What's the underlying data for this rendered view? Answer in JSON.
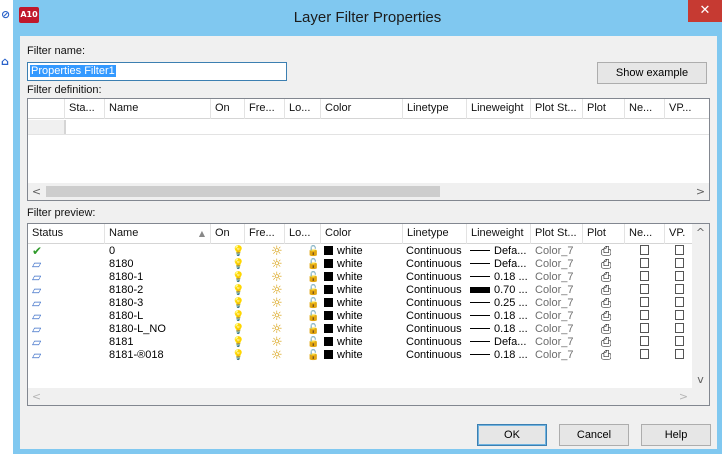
{
  "dialog": {
    "title": "Layer Filter Properties",
    "close_glyph": "✕",
    "app_icon_label": "A10"
  },
  "filter_name": {
    "label": "Filter name:",
    "value": "Properties Filter1"
  },
  "show_example_label": "Show example",
  "filter_definition": {
    "label": "Filter definition:",
    "columns": [
      "Sta...",
      "Name",
      "On",
      "Fre...",
      "Lo...",
      "Color",
      "Linetype",
      "Lineweight",
      "Plot St...",
      "Plot",
      "Ne...",
      "VP..."
    ]
  },
  "filter_preview": {
    "label": "Filter preview:",
    "columns": [
      "Status",
      "Name",
      "On",
      "Fre...",
      "Lo...",
      "Color",
      "Linetype",
      "Lineweight",
      "Plot St...",
      "Plot",
      "Ne...",
      "VP."
    ],
    "sort_indicator": "▲",
    "rows": [
      {
        "status": "current",
        "name": "0",
        "color": "white",
        "linetype": "Continuous",
        "lineweight": "Defa...",
        "lw_style": "thin",
        "plotstyle": "Color_7"
      },
      {
        "status": "layer",
        "name": "8180",
        "color": "white",
        "linetype": "Continuous",
        "lineweight": "Defa...",
        "lw_style": "thin",
        "plotstyle": "Color_7"
      },
      {
        "status": "layer",
        "name": "8180-1",
        "color": "white",
        "linetype": "Continuous",
        "lineweight": "0.18 ...",
        "lw_style": "thin",
        "plotstyle": "Color_7"
      },
      {
        "status": "layer",
        "name": "8180-2",
        "color": "white",
        "linetype": "Continuous",
        "lineweight": "0.70 ...",
        "lw_style": "thick",
        "plotstyle": "Color_7"
      },
      {
        "status": "layer",
        "name": "8180-3",
        "color": "white",
        "linetype": "Continuous",
        "lineweight": "0.25 ...",
        "lw_style": "thin",
        "plotstyle": "Color_7"
      },
      {
        "status": "layer",
        "name": "8180-L",
        "color": "white",
        "linetype": "Continuous",
        "lineweight": "0.18 ...",
        "lw_style": "thin",
        "plotstyle": "Color_7"
      },
      {
        "status": "layer",
        "name": "8180-L_NO",
        "color": "white",
        "linetype": "Continuous",
        "lineweight": "0.18 ...",
        "lw_style": "thin",
        "plotstyle": "Color_7"
      },
      {
        "status": "layer",
        "name": "8181",
        "color": "white",
        "linetype": "Continuous",
        "lineweight": "Defa...",
        "lw_style": "thin",
        "plotstyle": "Color_7"
      },
      {
        "status": "layer",
        "name": "8181-®018",
        "color": "white",
        "linetype": "Continuous",
        "lineweight": "0.18 ...",
        "lw_style": "thin",
        "plotstyle": "Color_7"
      }
    ]
  },
  "buttons": {
    "ok": "OK",
    "cancel": "Cancel",
    "help": "Help"
  },
  "icons": {
    "check": "✔",
    "layer": "▱",
    "bulb": "💡",
    "sun": "☼",
    "lock": "🔓",
    "printer": "⎙",
    "scroll_left": "<",
    "scroll_right": ">",
    "scroll_up": "^",
    "scroll_down": "v"
  },
  "colors": {
    "title_bar": "#80c8f0",
    "close_button": "#c63a32",
    "selection": "#3399ff",
    "status_check": "#2f9a2a",
    "layer_icon": "#3c6fc8",
    "bulb": "#e6b400",
    "sun": "#d59a00"
  }
}
